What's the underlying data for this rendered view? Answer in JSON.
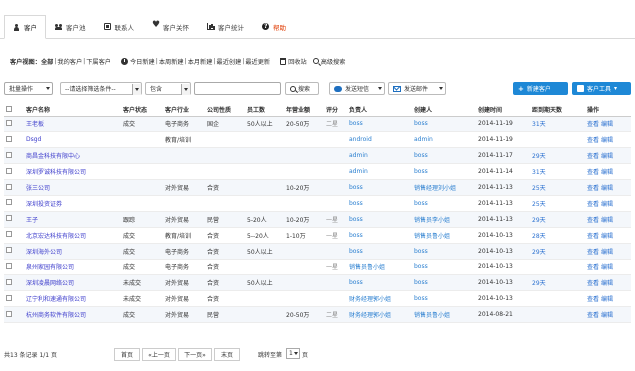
{
  "tabs": [
    {
      "label": "客户",
      "icon": "user-icon"
    },
    {
      "label": "客户池",
      "icon": "group-icon"
    },
    {
      "label": "联系人",
      "icon": "card-icon"
    },
    {
      "label": "客户关怀",
      "icon": "heart-icon"
    },
    {
      "label": "客户统计",
      "icon": "chart-icon"
    },
    {
      "label": "帮助",
      "icon": "help-icon"
    }
  ],
  "overview": {
    "title": "客户视图：",
    "all": "全部",
    "mine": "我的客户",
    "sub": "下属客户",
    "today_new": "今日新建",
    "week_new": "本周新建",
    "month_new": "本月新建",
    "recent_created": "最近创建",
    "recent_updated": "最近更新",
    "recycle": "回收站",
    "advanced_search": "高级搜索"
  },
  "toolbar": {
    "batch": "批量操作",
    "field_select": "--请选择筛选条件--",
    "condition": "包含",
    "search_value": "",
    "search_btn": "搜索",
    "sms_btn": "发送短信",
    "mail_btn": "发送邮件",
    "new_btn": "新建客户",
    "tools_btn": "客户工具"
  },
  "table": {
    "headers": [
      "客户名称",
      "客户状态",
      "客户行业",
      "公司性质",
      "员工数",
      "年营业额",
      "评分",
      "负责人",
      "创建人",
      "创建时间",
      "距到期天数",
      "操作"
    ],
    "op_view": "查看",
    "op_edit": "编辑",
    "rows": [
      {
        "name": "王老板",
        "status": "成交",
        "industry": "电子商务",
        "nature": "国企",
        "staff": "50人以上",
        "revenue": "20-50万",
        "score": "二星",
        "owner": "boss",
        "creator": "boss",
        "date": "2014-11-19",
        "days": "31天"
      },
      {
        "name": "Dsgd",
        "status": "",
        "industry": "教育/培训",
        "nature": "",
        "staff": "",
        "revenue": "",
        "score": "",
        "owner": "android",
        "creator": "admin",
        "date": "2014-11-19",
        "days": ""
      },
      {
        "name": "商昌金科技有限中心",
        "status": "",
        "industry": "",
        "nature": "",
        "staff": "",
        "revenue": "",
        "score": "",
        "owner": "admin",
        "creator": "boss",
        "date": "2014-11-17",
        "days": "29天"
      },
      {
        "name": "深圳罗诚科技有限公司",
        "status": "",
        "industry": "",
        "nature": "",
        "staff": "",
        "revenue": "",
        "score": "",
        "owner": "admin",
        "creator": "boss",
        "date": "2014-11-14",
        "days": "31天"
      },
      {
        "name": "张三公司",
        "status": "",
        "industry": "对外贸易",
        "nature": "合资",
        "staff": "",
        "revenue": "10-20万",
        "score": "",
        "owner": "boss",
        "creator": "销售经理刘小姐",
        "date": "2014-11-13",
        "days": "25天"
      },
      {
        "name": "深圳投资证券",
        "status": "",
        "industry": "",
        "nature": "",
        "staff": "",
        "revenue": "",
        "score": "",
        "owner": "boss",
        "creator": "boss",
        "date": "2014-11-13",
        "days": "25天"
      },
      {
        "name": "王子",
        "status": "跟踪",
        "industry": "对外贸易",
        "nature": "民营",
        "staff": "5-20人",
        "revenue": "10-20万",
        "score": "一星",
        "owner": "boss",
        "creator": "销售员李小姐",
        "date": "2014-11-13",
        "days": "29天"
      },
      {
        "name": "北京宏达科技有限公司",
        "status": "成交",
        "industry": "教育/培训",
        "nature": "合资",
        "staff": "5--20人",
        "revenue": "1-10万",
        "score": "一星",
        "owner": "boss",
        "creator": "销售员鲁小姐",
        "date": "2014-10-13",
        "days": "28天"
      },
      {
        "name": "深圳海外公司",
        "status": "成交",
        "industry": "电子商务",
        "nature": "合资",
        "staff": "50人以上",
        "revenue": "",
        "score": "",
        "owner": "boss",
        "creator": "boss",
        "date": "2014-10-13",
        "days": "29天"
      },
      {
        "name": "泉州家园有限公司",
        "status": "成交",
        "industry": "电子商务",
        "nature": "合资",
        "staff": "",
        "revenue": "",
        "score": "一星",
        "owner": "销售员鲁小姐",
        "creator": "boss",
        "date": "2014-10-13",
        "days": ""
      },
      {
        "name": "深圳凌晨网络公司",
        "status": "未成交",
        "industry": "对外贸易",
        "nature": "合资",
        "staff": "50人以上",
        "revenue": "",
        "score": "",
        "owner": "boss",
        "creator": "boss",
        "date": "2014-10-13",
        "days": "29天"
      },
      {
        "name": "辽宁利和速通有限公司",
        "status": "未成交",
        "industry": "对外贸易",
        "nature": "合资",
        "staff": "",
        "revenue": "",
        "score": "",
        "owner": "财务经理郭小姐",
        "creator": "boss",
        "date": "2014-10-13",
        "days": ""
      },
      {
        "name": "杭州商务软件有限公司",
        "status": "成交",
        "industry": "对外贸易",
        "nature": "民营",
        "staff": "",
        "revenue": "20-50万",
        "score": "二星",
        "owner": "财务经理郭小姐",
        "creator": "销售员鲁小姐",
        "date": "2014-08-21",
        "days": ""
      }
    ]
  },
  "footer": {
    "count": "共13 条记录 1/1 页",
    "first": "首页",
    "prev": "«上一页",
    "next": "下一页»",
    "last": "末页",
    "jump_label": "跳转至第",
    "jump_value": "1",
    "jump_suffix": "页"
  },
  "colors": {
    "accent": "#1e88d6",
    "link": "#3d3dcc",
    "help": "#e03a00"
  }
}
